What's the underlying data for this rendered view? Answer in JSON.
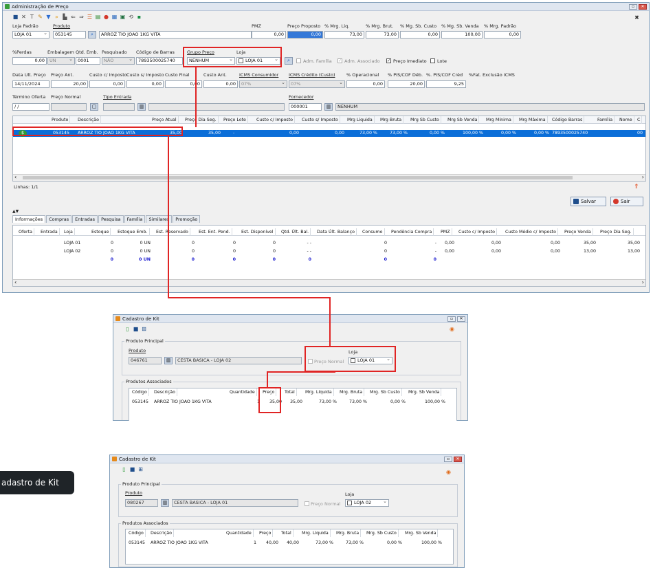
{
  "main_window": {
    "title": "Administração de Preço",
    "toolbar_icons": [
      "save-icon",
      "delete-icon",
      "text-icon",
      "tools-icon",
      "filter-icon",
      "forward-icon",
      "print-icon",
      "back-icon",
      "next-icon",
      "list-icon",
      "report-icon",
      "stop-icon",
      "grid-icon",
      "export-icon",
      "sync-icon",
      "excel-icon"
    ],
    "row1": {
      "loja_padrao_label": "Loja Padrão",
      "loja_padrao_value": "LOJA 01",
      "produto_label": "Produto",
      "produto_code": "053145",
      "produto_desc": "ARROZ TIO JOAO 1KG VITA",
      "pmz_label": "PMZ",
      "pmz_value": "0,00",
      "preco_proposto_label": "Preço Proposto",
      "preco_proposto_value": "0,00",
      "mrg_liq_label": "% Mrg. Liq.",
      "mrg_liq_value": "73,00",
      "mrg_brut_label": "% Mrg. Brut.",
      "mrg_brut_value": "73,00",
      "mg_sb_custo_label": "% Mg. Sb. Custo",
      "mg_sb_custo_value": "0,00",
      "mg_sb_venda_label": "% Mg. Sb. Venda",
      "mg_sb_venda_value": "100,00",
      "mrg_padrao_label": "% Mrg. Padrão",
      "mrg_padrao_value": "0,00"
    },
    "row2": {
      "perdas_label": "%Perdas",
      "perdas_value": "0,00",
      "embalagem_label": "Embalagem",
      "embalagem_value": "UN",
      "qtd_emb_label": "Qtd. Emb.",
      "qtd_emb_value": "0001",
      "pesquisado_label": "Pesquisado",
      "pesquisado_value": "NÃO",
      "codigo_barras_label": "Código de Barras",
      "codigo_barras_value": "7893500025740",
      "grupo_preco_label": "Grupo Preço",
      "grupo_preco_value": "NENHUM",
      "loja_label": "Loja",
      "loja_value": "LOJA 01",
      "adm_familia_label": "Adm. Família",
      "adm_associado_label": "Adm. Associado",
      "preco_imediato_label": "Preço Imediato",
      "lote_label": "Lote"
    },
    "row3": {
      "data_ult_preco_label": "Data Ult. Preço",
      "data_ult_preco_value": "14/11/2024",
      "preco_ant_label": "Preço Ant.",
      "preco_ant_value": "20,00",
      "custo_c_imp_label": "Custo c/ Imposto",
      "custo_c_imp_value": "0,00",
      "custo_s_imp_label": "Custo s/ Imposto",
      "custo_s_imp_value": "0,00",
      "custo_final_label": "Custo Final",
      "custo_final_value": "0,00",
      "custo_ant_label": "Custo Ant.",
      "custo_ant_value": "0,00",
      "icms_consumidor_label": "ICMS Consumidor",
      "icms_consumidor_value": "07%",
      "icms_credito_label": "ICMS Crédito (Custo)",
      "icms_credito_value": "07%",
      "operacional_label": "% Operacional",
      "operacional_value": "0,00",
      "pis_cof_deb_label": "% PIS/COF Déb.",
      "pis_cof_deb_value": "20,00",
      "pis_cof_cred_label": "%. PIS/COF Créd",
      "pis_cof_cred_value": "9,25",
      "fat_exclusao_label": "%Fat. Exclusão ICMS"
    },
    "row4": {
      "termino_oferta_label": "Término Oferta",
      "termino_oferta_value": "/ /",
      "preco_normal_label": "Preço Normal",
      "tipo_entrada_label": "Tipo Entrada",
      "fornecedor_label": "Fornecedor",
      "fornecedor_code": "000001",
      "fornecedor_name": "NENHUM"
    },
    "grid": {
      "headers": [
        "Produto",
        "Descrição",
        "Preço Atual",
        "Preço Dia Seg.",
        "Preço Lote",
        "Custo c/ Imposto",
        "Custo s/ Imposto",
        "Mrg Líquida",
        "Mrg Bruta",
        "Mrg Sb Custo",
        "Mrg Sb Venda",
        "Mrg Mínima",
        "Mrg Máxima",
        "Código Barras",
        "Família",
        "Nome",
        "C"
      ],
      "row": [
        "053145",
        "ARROZ TIO JOAO 1KG VITA",
        "35,00",
        "35,00",
        "-",
        "0,00",
        "0,00",
        "73,00 %",
        "73,00 %",
        "0,00 %",
        "100,00 %",
        "0,00 %",
        "0,00 %",
        "7893500025740",
        "",
        "",
        "00"
      ]
    },
    "linhas": "Linhas: 1/1",
    "salvar_label": "Salvar",
    "sair_label": "Sair",
    "tabs": [
      "Informações",
      "Compras",
      "Entradas",
      "Pesquisa",
      "Família",
      "Similares",
      "Promoção"
    ],
    "info_grid": {
      "headers": [
        "Oferta",
        "Entrada",
        "Loja",
        "Estoque",
        "Estoque Emb.",
        "Est. Reservado",
        "Est. Ent. Pend.",
        "Est. Disponível",
        "Qtd. Últ. Bal.",
        "Data Últ. Balanço",
        "Consumo",
        "Pendência Compra",
        "PMZ",
        "Custo c/ Imposto",
        "Custo Médio c/ Imposto",
        "Preço Venda",
        "Preço Dia Seg."
      ],
      "rows": [
        [
          "",
          "",
          "LOJA 01",
          "0",
          "0 UN",
          "0",
          "0",
          "0",
          "- -",
          "",
          "0",
          "-",
          "0,00",
          "0,00",
          "0,00",
          "35,00",
          "35,00"
        ],
        [
          "",
          "",
          "LOJA 02",
          "0",
          "0 UN",
          "0",
          "0",
          "0",
          "- -",
          "",
          "0",
          "-",
          "0,00",
          "0,00",
          "0,00",
          "13,00",
          "13,00"
        ],
        [
          "",
          "",
          "",
          "0",
          "0 UN",
          "0",
          "0",
          "0",
          "0",
          "",
          "0",
          "0",
          "",
          "",
          "",
          "",
          ""
        ]
      ]
    }
  },
  "kit_window_1": {
    "title": "Cadastro de Kit",
    "produto_principal_label": "Produto Principal",
    "produto_label": "Produto",
    "produto_code": "046761",
    "produto_desc": "CESTA BASICA - LOJA 02",
    "preco_normal_label": "Preço Normal",
    "loja_label": "Loja",
    "loja_value": "LOJA 01",
    "associados_label": "Produtos Associados",
    "headers": [
      "Código",
      "Descrição",
      "Quantidade",
      "Preço",
      "Total",
      "Mrg. Líquida",
      "Mrg. Bruta",
      "Mrg. Sb Custo",
      "Mrg. Sb Venda"
    ],
    "row": [
      "053145",
      "ARROZ TIO JOAO 1KG VITA",
      "1",
      "35,00",
      "35,00",
      "73,00 %",
      "73,00 %",
      "0,00 %",
      "100,00 %"
    ]
  },
  "kit_window_2": {
    "title": "Cadastro de Kit",
    "produto_principal_label": "Produto Principal",
    "produto_label": "Produto",
    "produto_code": "080267",
    "produto_desc": "CESTA BASICA - LOJA 01",
    "preco_normal_label": "Preço Normal",
    "loja_label": "Loja",
    "loja_value": "LOJA 02",
    "associados_label": "Produtos Associados",
    "headers": [
      "Código",
      "Descrição",
      "Quantidade",
      "Preço",
      "Total",
      "Mrg. Líquida",
      "Mrg. Bruta",
      "Mrg. Sb Custo",
      "Mrg. Sb Venda"
    ],
    "row": [
      "053145",
      "ARROZ TIO JOAO 1KG VITA",
      "1",
      "40,00",
      "40,00",
      "73,00 %",
      "73,00 %",
      "0,00 %",
      "100,00 %"
    ]
  },
  "tooltip_text": "adastro de Kit",
  "colors": {
    "highlight": "#e02424",
    "selection": "#0b6ed8",
    "accent": "#3478d8"
  }
}
